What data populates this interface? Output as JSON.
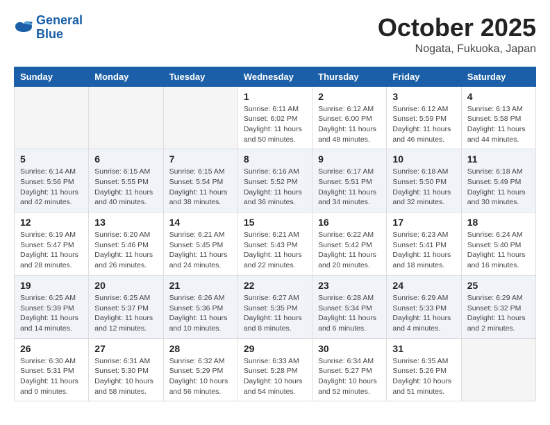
{
  "header": {
    "logo_line1": "General",
    "logo_line2": "Blue",
    "month": "October 2025",
    "location": "Nogata, Fukuoka, Japan"
  },
  "weekdays": [
    "Sunday",
    "Monday",
    "Tuesday",
    "Wednesday",
    "Thursday",
    "Friday",
    "Saturday"
  ],
  "weeks": [
    [
      {
        "day": "",
        "info": ""
      },
      {
        "day": "",
        "info": ""
      },
      {
        "day": "",
        "info": ""
      },
      {
        "day": "1",
        "info": "Sunrise: 6:11 AM\nSunset: 6:02 PM\nDaylight: 11 hours\nand 50 minutes."
      },
      {
        "day": "2",
        "info": "Sunrise: 6:12 AM\nSunset: 6:00 PM\nDaylight: 11 hours\nand 48 minutes."
      },
      {
        "day": "3",
        "info": "Sunrise: 6:12 AM\nSunset: 5:59 PM\nDaylight: 11 hours\nand 46 minutes."
      },
      {
        "day": "4",
        "info": "Sunrise: 6:13 AM\nSunset: 5:58 PM\nDaylight: 11 hours\nand 44 minutes."
      }
    ],
    [
      {
        "day": "5",
        "info": "Sunrise: 6:14 AM\nSunset: 5:56 PM\nDaylight: 11 hours\nand 42 minutes."
      },
      {
        "day": "6",
        "info": "Sunrise: 6:15 AM\nSunset: 5:55 PM\nDaylight: 11 hours\nand 40 minutes."
      },
      {
        "day": "7",
        "info": "Sunrise: 6:15 AM\nSunset: 5:54 PM\nDaylight: 11 hours\nand 38 minutes."
      },
      {
        "day": "8",
        "info": "Sunrise: 6:16 AM\nSunset: 5:52 PM\nDaylight: 11 hours\nand 36 minutes."
      },
      {
        "day": "9",
        "info": "Sunrise: 6:17 AM\nSunset: 5:51 PM\nDaylight: 11 hours\nand 34 minutes."
      },
      {
        "day": "10",
        "info": "Sunrise: 6:18 AM\nSunset: 5:50 PM\nDaylight: 11 hours\nand 32 minutes."
      },
      {
        "day": "11",
        "info": "Sunrise: 6:18 AM\nSunset: 5:49 PM\nDaylight: 11 hours\nand 30 minutes."
      }
    ],
    [
      {
        "day": "12",
        "info": "Sunrise: 6:19 AM\nSunset: 5:47 PM\nDaylight: 11 hours\nand 28 minutes."
      },
      {
        "day": "13",
        "info": "Sunrise: 6:20 AM\nSunset: 5:46 PM\nDaylight: 11 hours\nand 26 minutes."
      },
      {
        "day": "14",
        "info": "Sunrise: 6:21 AM\nSunset: 5:45 PM\nDaylight: 11 hours\nand 24 minutes."
      },
      {
        "day": "15",
        "info": "Sunrise: 6:21 AM\nSunset: 5:43 PM\nDaylight: 11 hours\nand 22 minutes."
      },
      {
        "day": "16",
        "info": "Sunrise: 6:22 AM\nSunset: 5:42 PM\nDaylight: 11 hours\nand 20 minutes."
      },
      {
        "day": "17",
        "info": "Sunrise: 6:23 AM\nSunset: 5:41 PM\nDaylight: 11 hours\nand 18 minutes."
      },
      {
        "day": "18",
        "info": "Sunrise: 6:24 AM\nSunset: 5:40 PM\nDaylight: 11 hours\nand 16 minutes."
      }
    ],
    [
      {
        "day": "19",
        "info": "Sunrise: 6:25 AM\nSunset: 5:39 PM\nDaylight: 11 hours\nand 14 minutes."
      },
      {
        "day": "20",
        "info": "Sunrise: 6:25 AM\nSunset: 5:37 PM\nDaylight: 11 hours\nand 12 minutes."
      },
      {
        "day": "21",
        "info": "Sunrise: 6:26 AM\nSunset: 5:36 PM\nDaylight: 11 hours\nand 10 minutes."
      },
      {
        "day": "22",
        "info": "Sunrise: 6:27 AM\nSunset: 5:35 PM\nDaylight: 11 hours\nand 8 minutes."
      },
      {
        "day": "23",
        "info": "Sunrise: 6:28 AM\nSunset: 5:34 PM\nDaylight: 11 hours\nand 6 minutes."
      },
      {
        "day": "24",
        "info": "Sunrise: 6:29 AM\nSunset: 5:33 PM\nDaylight: 11 hours\nand 4 minutes."
      },
      {
        "day": "25",
        "info": "Sunrise: 6:29 AM\nSunset: 5:32 PM\nDaylight: 11 hours\nand 2 minutes."
      }
    ],
    [
      {
        "day": "26",
        "info": "Sunrise: 6:30 AM\nSunset: 5:31 PM\nDaylight: 11 hours\nand 0 minutes."
      },
      {
        "day": "27",
        "info": "Sunrise: 6:31 AM\nSunset: 5:30 PM\nDaylight: 10 hours\nand 58 minutes."
      },
      {
        "day": "28",
        "info": "Sunrise: 6:32 AM\nSunset: 5:29 PM\nDaylight: 10 hours\nand 56 minutes."
      },
      {
        "day": "29",
        "info": "Sunrise: 6:33 AM\nSunset: 5:28 PM\nDaylight: 10 hours\nand 54 minutes."
      },
      {
        "day": "30",
        "info": "Sunrise: 6:34 AM\nSunset: 5:27 PM\nDaylight: 10 hours\nand 52 minutes."
      },
      {
        "day": "31",
        "info": "Sunrise: 6:35 AM\nSunset: 5:26 PM\nDaylight: 10 hours\nand 51 minutes."
      },
      {
        "day": "",
        "info": ""
      }
    ]
  ]
}
